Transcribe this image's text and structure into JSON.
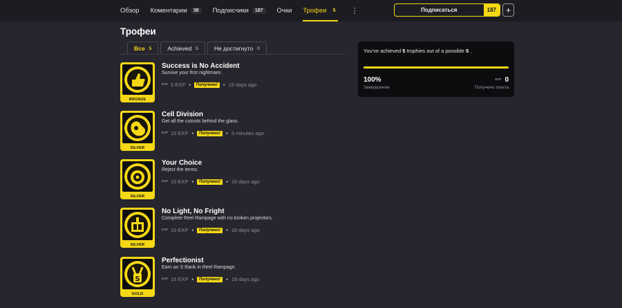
{
  "nav": {
    "items": [
      {
        "label": "Обзор",
        "count": null,
        "active": false
      },
      {
        "label": "Коментарии",
        "count": "38",
        "active": false
      },
      {
        "label": "Подписчики",
        "count": "187",
        "active": false
      },
      {
        "label": "Очки",
        "count": null,
        "active": false
      },
      {
        "label": "Трофеи",
        "count": "5",
        "active": true
      }
    ],
    "more": "⋮",
    "follow_label": "Подписаться",
    "follow_count": "187",
    "plus": "+"
  },
  "page_title": "Трофеи",
  "tabs": [
    {
      "label": "Все",
      "count": "5",
      "active": true
    },
    {
      "label": "Achieved",
      "count": "5",
      "active": false
    },
    {
      "label": "Не достигнуто",
      "count": "0",
      "active": false
    }
  ],
  "exp_icon": "EXP",
  "trophies": [
    {
      "name": "Success is No Accident",
      "desc": "Survive your first nightmare.",
      "exp": "5 EXP",
      "status": "Получено!",
      "ago": "19 days ago",
      "tier": "BRONZE",
      "icon": "thumbs-up-icon"
    },
    {
      "name": "Cell Division",
      "desc": "Get all the cutouts behind the glass.",
      "exp": "10 EXP",
      "status": "Получено!",
      "ago": "3 minutes ago",
      "tier": "SILVER",
      "icon": "cutout-icon"
    },
    {
      "name": "Your Choice",
      "desc": "Reject the terms.",
      "exp": "10 EXP",
      "status": "Получено!",
      "ago": "16 days ago",
      "tier": "SILVER",
      "icon": "face-icon"
    },
    {
      "name": "No Light, No Fright",
      "desc": "Complete Reel Rampage with no broken projectors.",
      "exp": "10 EXP",
      "status": "Получено!",
      "ago": "18 days ago",
      "tier": "SILVER",
      "icon": "projector-icon"
    },
    {
      "name": "Perfectionist",
      "desc": "Earn an S Rank in Reel Rampage.",
      "exp": "15 EXP",
      "status": "Получено!",
      "ago": "18 days ago",
      "tier": "GOLD",
      "icon": "s-rank-icon"
    }
  ],
  "summary": {
    "prefix": "You've achieved",
    "achieved": "5",
    "middle": "trophies out of a possible",
    "possible": "5",
    "suffix": ".",
    "percent": "100%",
    "percent_value": 100,
    "percent_label": "Завершение",
    "exp_value": "0",
    "exp_label": "Получено опыта"
  },
  "colors": {
    "accent": "#f5d816",
    "background": "#27262e",
    "topbar": "#1d1c22",
    "card": "#0d0d10"
  }
}
